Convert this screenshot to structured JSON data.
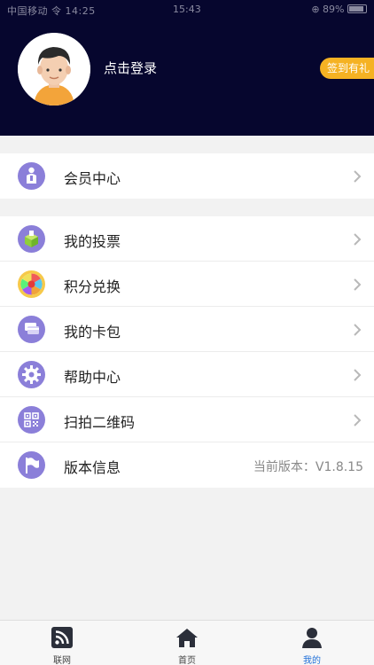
{
  "status_bar": {
    "left": "中国移动 令 14:25",
    "center": "15:43",
    "right": "⊕ 89%"
  },
  "profile": {
    "login_text": "点击登录",
    "signin_label": "签到有礼"
  },
  "groups": {
    "member": {
      "label": "会员中心"
    },
    "vote": {
      "label": "我的投票"
    },
    "points": {
      "label": "积分兑换"
    },
    "cards": {
      "label": "我的卡包"
    },
    "help": {
      "label": "帮助中心"
    },
    "scan": {
      "label": "扫拍二维码"
    },
    "version": {
      "label": "版本信息",
      "value": "当前版本：V1.8.15"
    }
  },
  "tabbar": {
    "tabs": [
      {
        "label": "联网",
        "icon": "rss-icon"
      },
      {
        "label": "首页",
        "icon": "home-icon"
      },
      {
        "label": "我的",
        "icon": "user-icon"
      }
    ],
    "active_index": 2
  },
  "colors": {
    "header_bg": "#06062e",
    "icon_bg": "#8b7fd9",
    "signin_bg": "#f5b223",
    "active_tab": "#1f6fd8"
  }
}
